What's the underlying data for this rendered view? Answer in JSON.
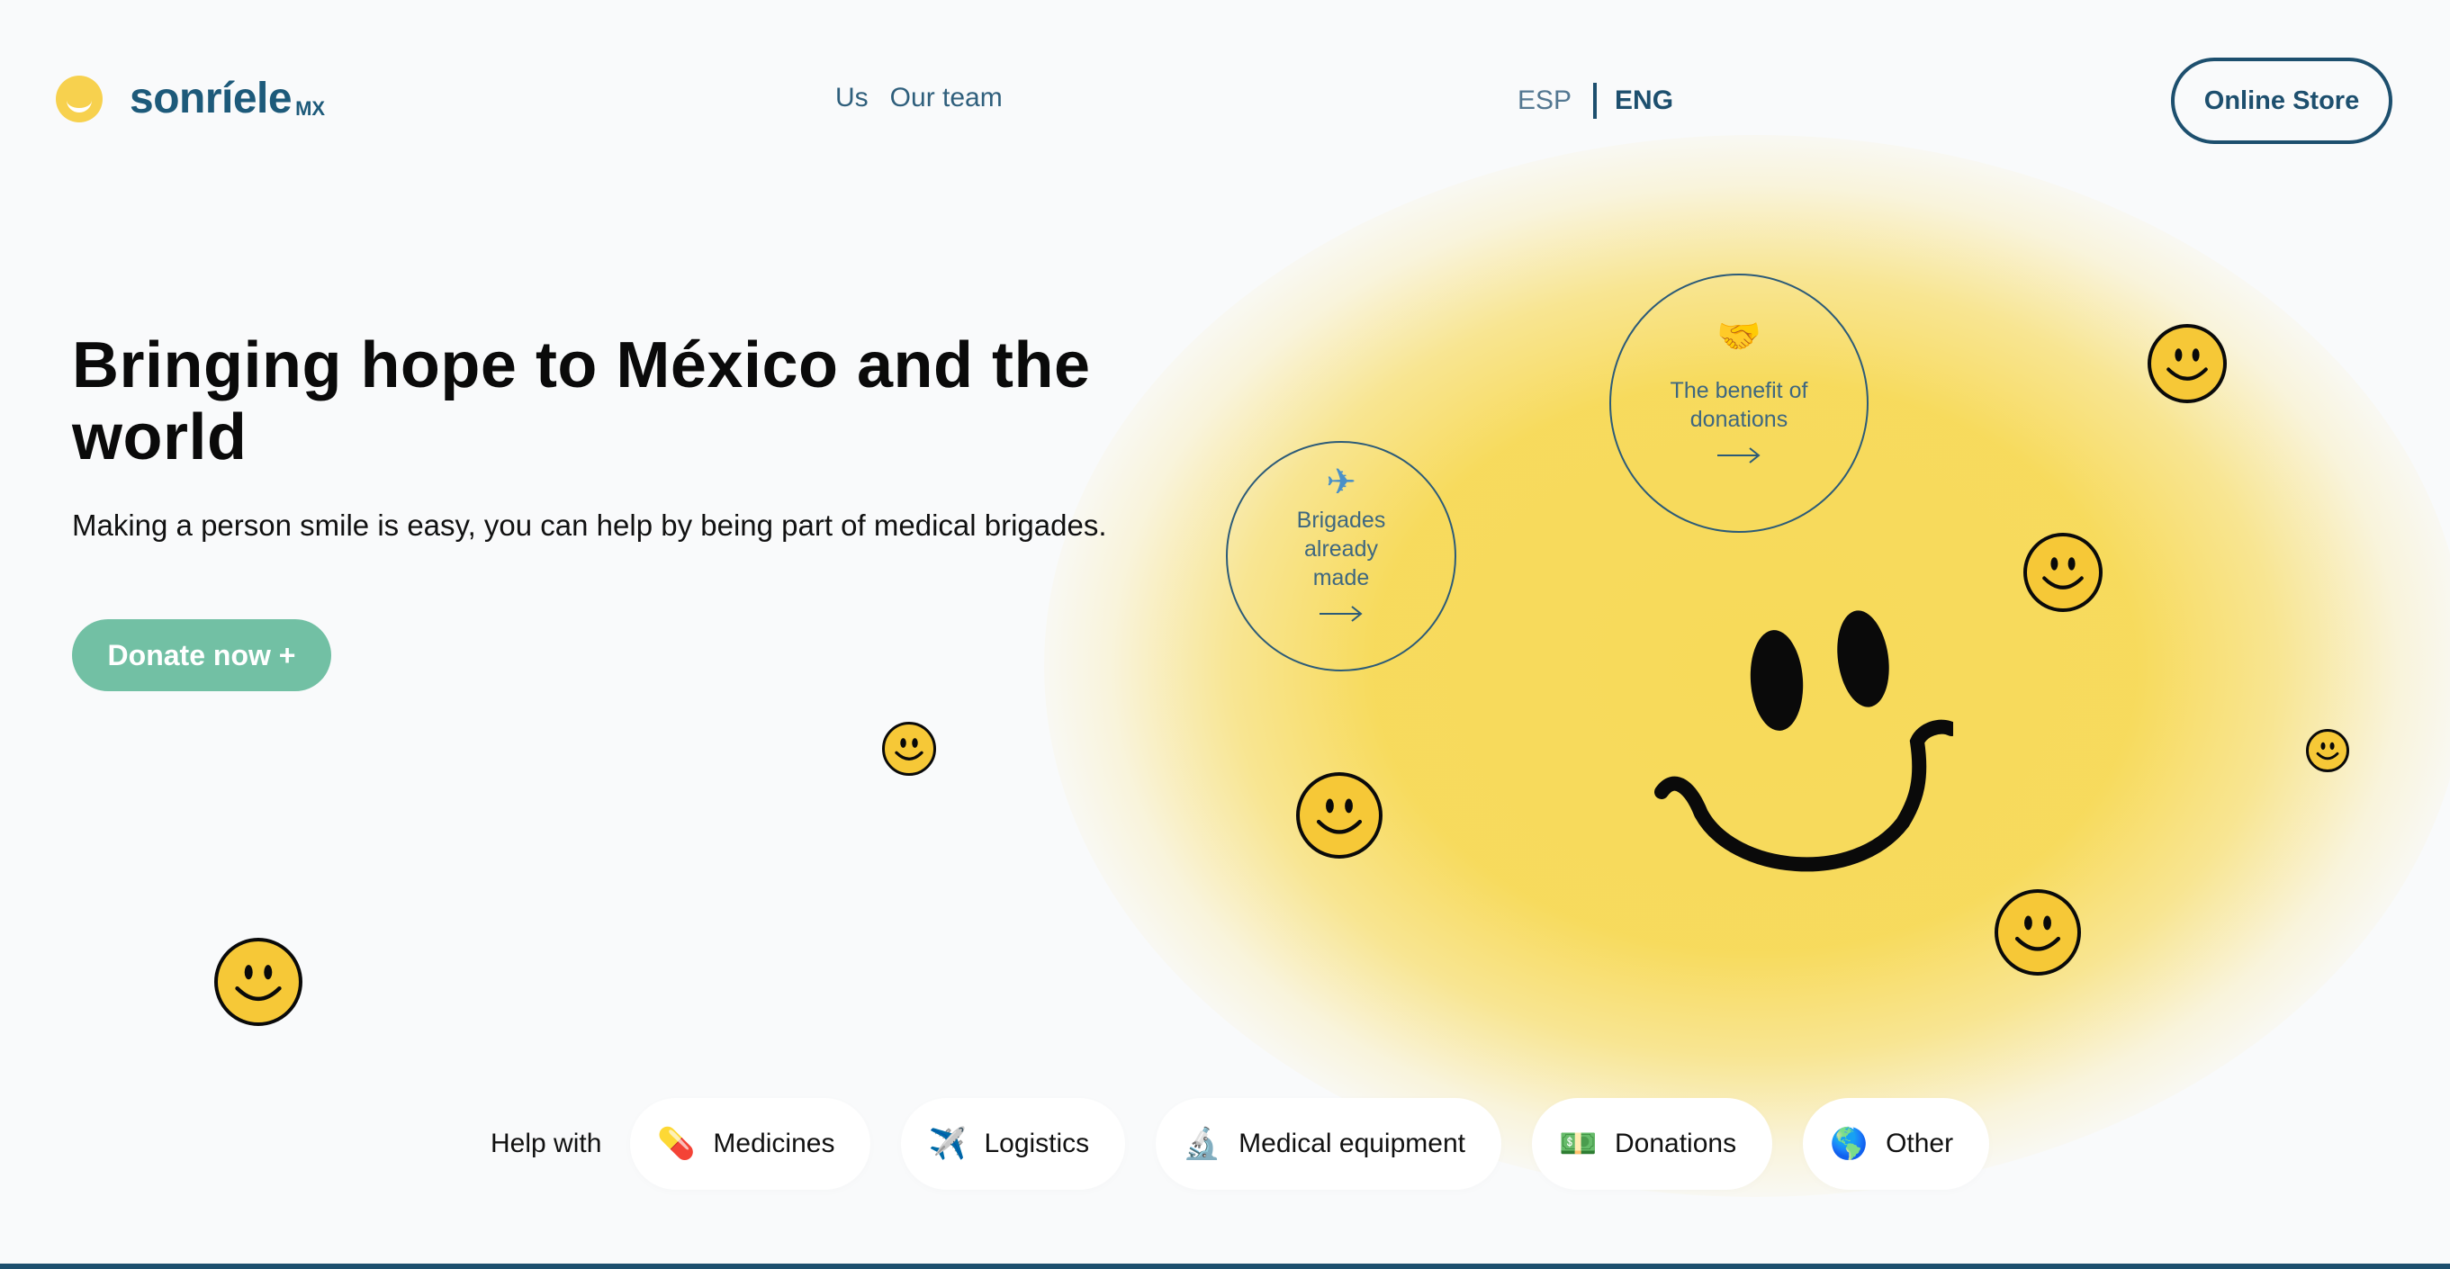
{
  "header": {
    "logo_text": "sonríele",
    "logo_sub": "MX",
    "nav": [
      "Us",
      "Our team"
    ],
    "lang": {
      "esp": "ESP",
      "eng": "ENG",
      "active": "ENG"
    },
    "store_button": "Online Store"
  },
  "hero": {
    "title": "Bringing hope to México and the world",
    "subtitle": "Making a person smile is easy, you can help by being part of medical brigades.",
    "donate_button": "Donate now +"
  },
  "circles": [
    {
      "icon": "✈",
      "icon_name": "airplane-icon",
      "label": "Brigades already made",
      "arrow": "⟶"
    },
    {
      "icon": "🤝",
      "icon_name": "handshake-icon",
      "label": "The benefit of donations",
      "arrow": "⟶"
    }
  ],
  "help": {
    "label": "Help with",
    "items": [
      {
        "icon": "💊",
        "icon_name": "pill-icon",
        "label": "Medicines"
      },
      {
        "icon": "✈️",
        "icon_name": "airplane-icon",
        "label": "Logistics"
      },
      {
        "icon": "🔬",
        "icon_name": "microscope-icon",
        "label": "Medical equipment"
      },
      {
        "icon": "💵",
        "icon_name": "money-icon",
        "label": "Donations"
      },
      {
        "icon": "🌎",
        "icon_name": "globe-icon",
        "label": "Other"
      }
    ]
  },
  "colors": {
    "brand": "#1d5a7a",
    "accent_yellow": "#f7d14e",
    "donate_green": "#72c0a4",
    "background": "#f9fafb"
  }
}
